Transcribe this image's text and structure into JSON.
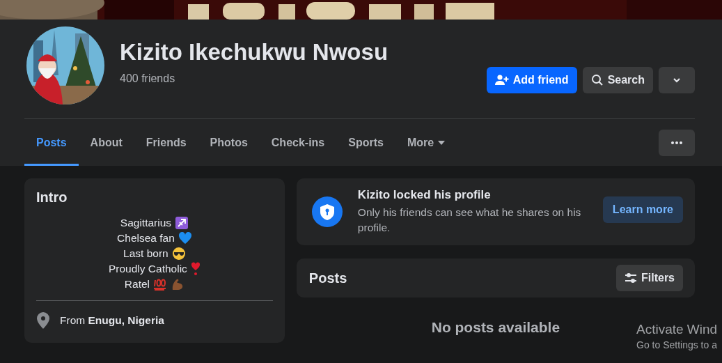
{
  "profile": {
    "name": "Kizito Ikechukwu Nwosu",
    "friends_count": "400 friends"
  },
  "actions": [
    {
      "label": "Add friend",
      "kind": "primary"
    },
    {
      "label": "Search",
      "kind": "secondary"
    },
    {
      "kind": "dropdown"
    }
  ],
  "tabs": [
    {
      "label": "Posts",
      "selected": true
    },
    {
      "label": "About",
      "selected": false
    },
    {
      "label": "Friends",
      "selected": false
    },
    {
      "label": "Photos",
      "selected": false
    },
    {
      "label": "Check-ins",
      "selected": false
    },
    {
      "label": "Sports",
      "selected": false
    },
    {
      "label": "More",
      "selected": false,
      "kind": "menu"
    }
  ],
  "intro": {
    "title": "Intro",
    "bio": [
      {
        "text": "Sagittarius",
        "icons": [
          {
            "kind": "zodiac"
          }
        ]
      },
      {
        "text": "Chelsea fan",
        "icons": [
          {
            "kind": "heart"
          }
        ]
      },
      {
        "text": "Last born",
        "icons": [
          {
            "kind": "cool-face"
          }
        ]
      },
      {
        "text": "Proudly Catholic",
        "icons": [
          {
            "kind": "exclamation-heart"
          }
        ]
      },
      {
        "text": "Ratel",
        "icons": [
          {
            "kind": "hundred"
          },
          {
            "kind": "muscle"
          }
        ]
      }
    ],
    "location": {
      "prefix": "From",
      "place": "Enugu, Nigeria"
    }
  },
  "locked_notice": {
    "title": "Kizito locked his profile",
    "text": "Only his friends can see what he shares on his profile.",
    "button": "Learn more"
  },
  "posts": {
    "title": "Posts",
    "filter_button": "Filters",
    "empty_text": "No posts available"
  },
  "os_overlay": {
    "title": "Activate Wind",
    "subtitle": "Go to Settings to a"
  }
}
